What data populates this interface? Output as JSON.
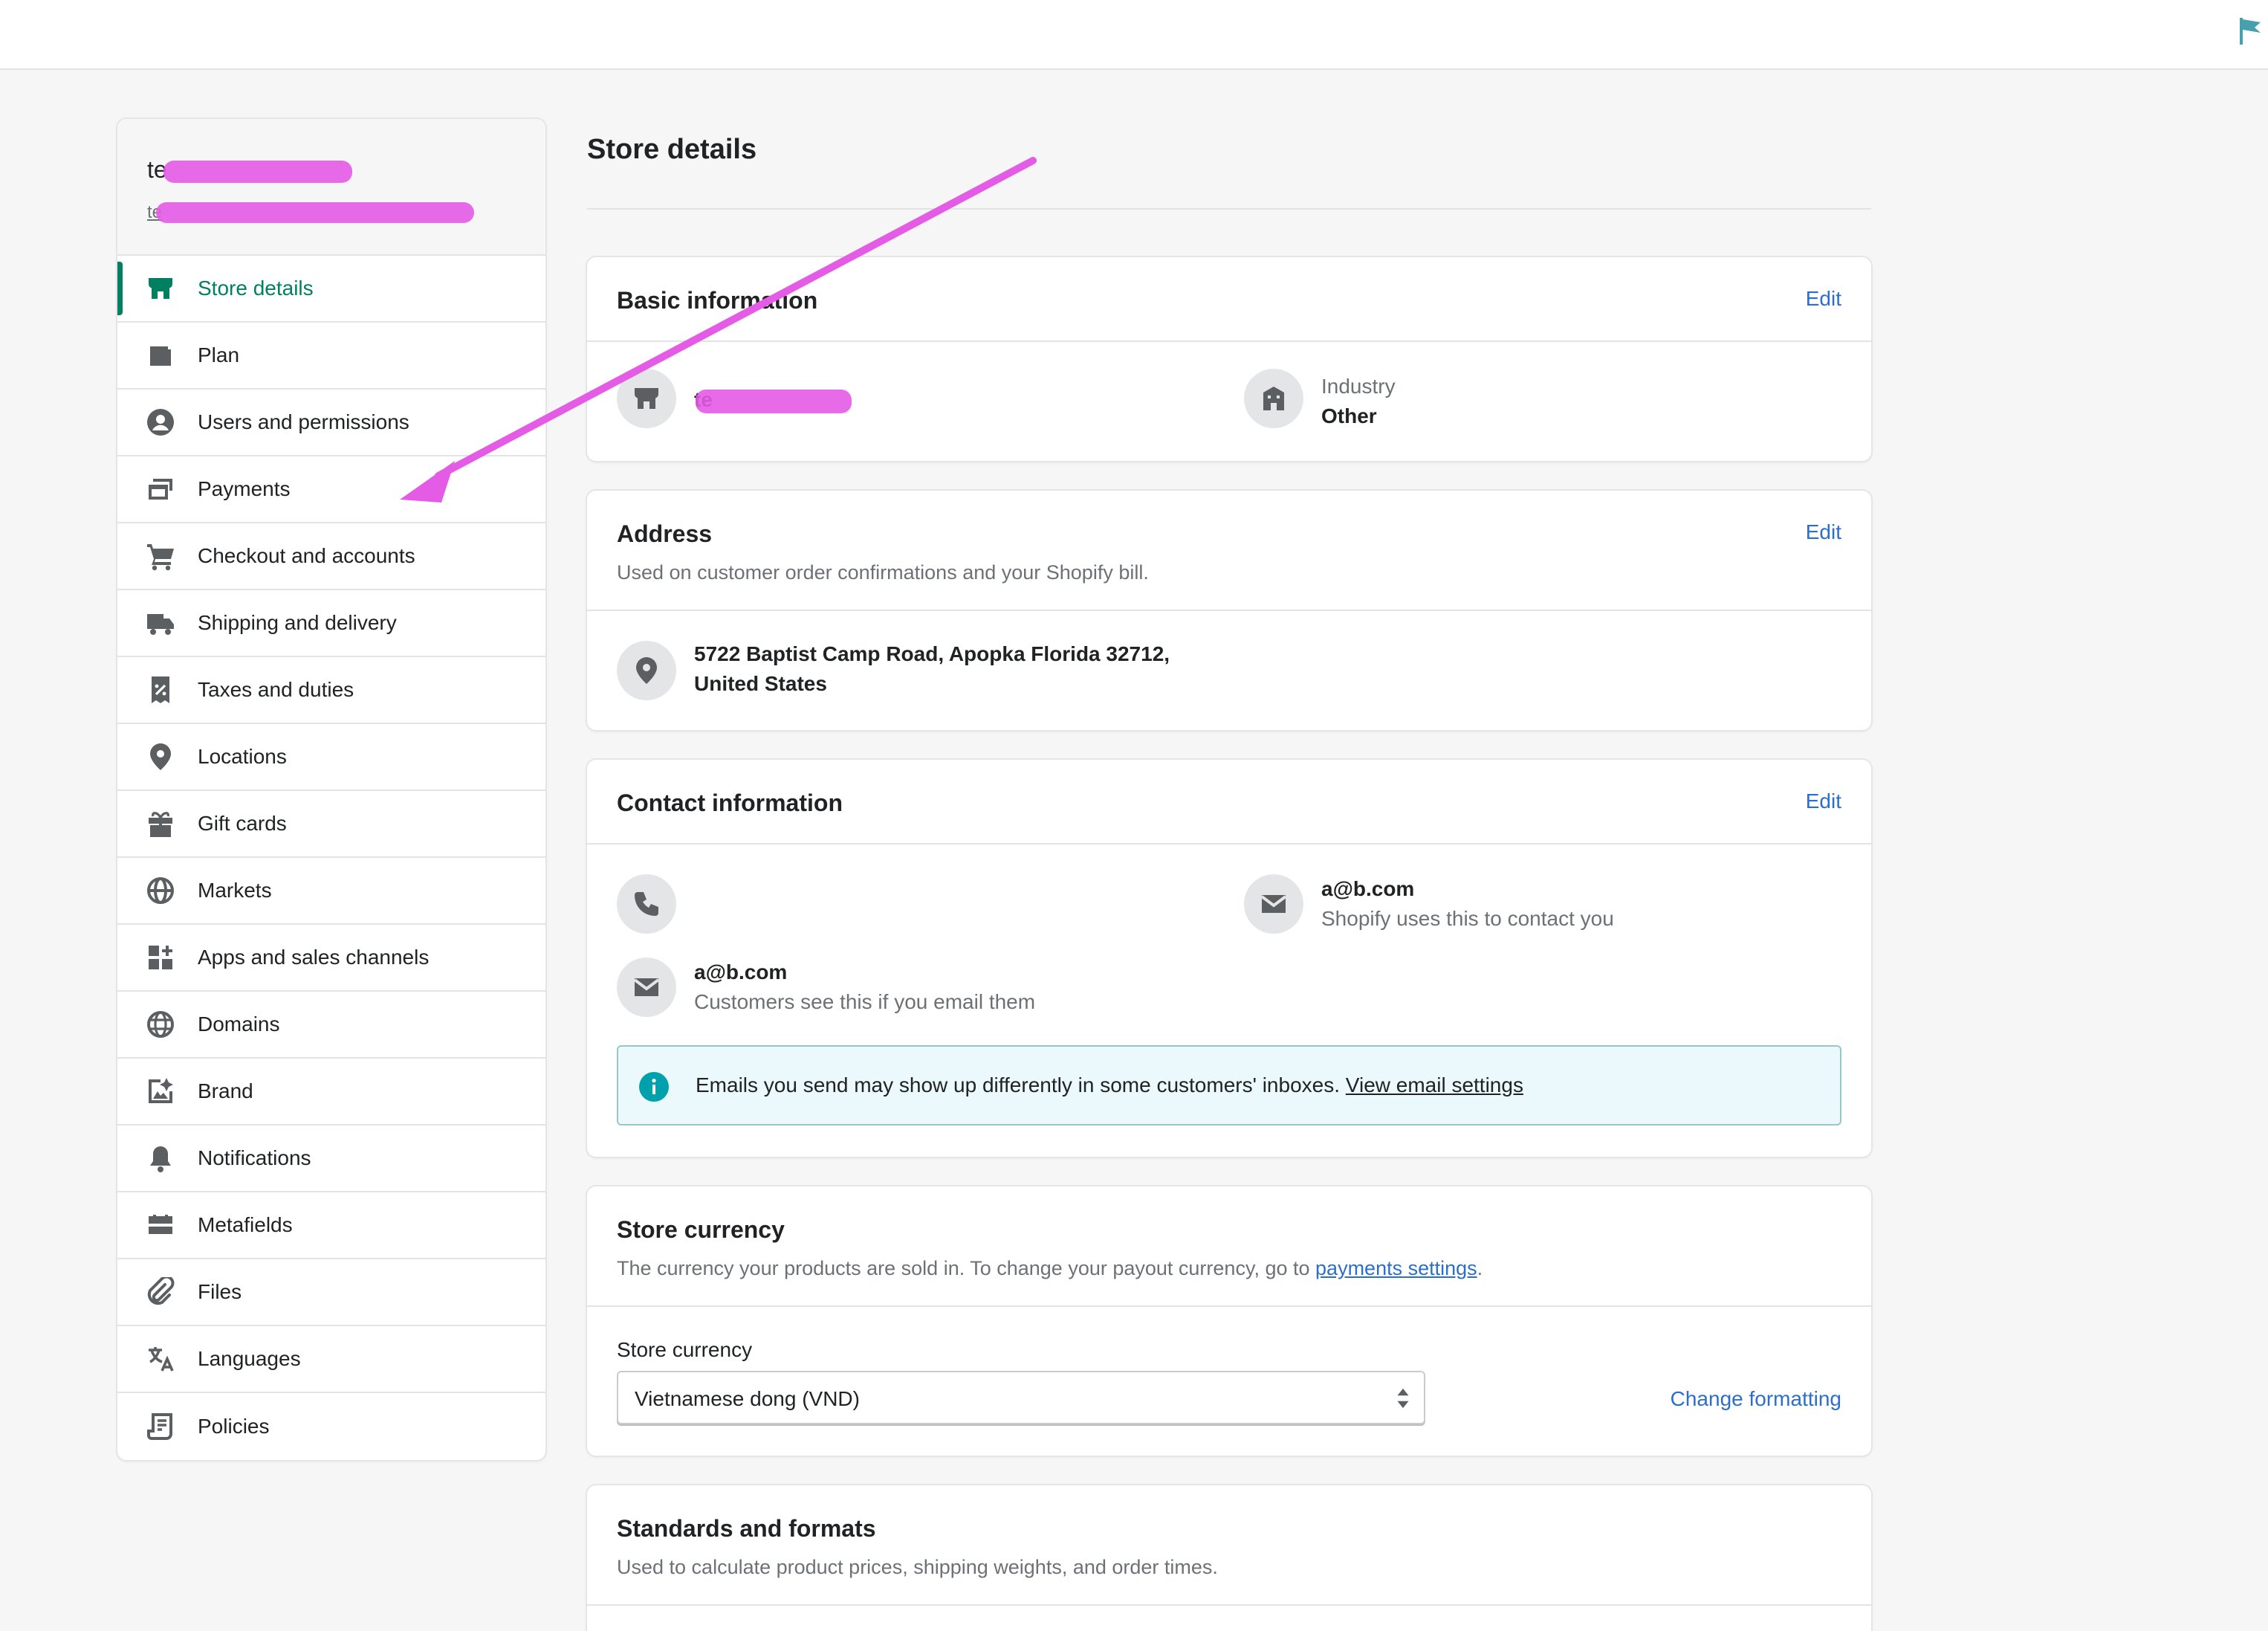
{
  "page": {
    "title": "Store details"
  },
  "sidebar": {
    "store_name": "te",
    "store_url": "te",
    "items": [
      {
        "label": "Store details",
        "icon": "store-icon",
        "active": true
      },
      {
        "label": "Plan",
        "icon": "wallet-icon"
      },
      {
        "label": "Users and permissions",
        "icon": "user-icon"
      },
      {
        "label": "Payments",
        "icon": "payments-icon"
      },
      {
        "label": "Checkout and accounts",
        "icon": "cart-icon"
      },
      {
        "label": "Shipping and delivery",
        "icon": "truck-icon"
      },
      {
        "label": "Taxes and duties",
        "icon": "tax-receipt-icon"
      },
      {
        "label": "Locations",
        "icon": "location-pin-icon"
      },
      {
        "label": "Gift cards",
        "icon": "gift-icon"
      },
      {
        "label": "Markets",
        "icon": "markets-globe-icon"
      },
      {
        "label": "Apps and sales channels",
        "icon": "apps-icon"
      },
      {
        "label": "Domains",
        "icon": "globe-icon"
      },
      {
        "label": "Brand",
        "icon": "brand-icon"
      },
      {
        "label": "Notifications",
        "icon": "bell-icon"
      },
      {
        "label": "Metafields",
        "icon": "metafields-icon"
      },
      {
        "label": "Files",
        "icon": "paperclip-icon"
      },
      {
        "label": "Languages",
        "icon": "translate-icon"
      },
      {
        "label": "Policies",
        "icon": "policy-document-icon"
      }
    ]
  },
  "basic_info": {
    "title": "Basic information",
    "edit": "Edit",
    "store_name": "te",
    "industry_label": "Industry",
    "industry_value": "Other"
  },
  "address": {
    "title": "Address",
    "edit": "Edit",
    "subtitle": "Used on customer order confirmations and your Shopify bill.",
    "line1": "5722 Baptist Camp Road, Apopka Florida 32712,",
    "line2": "United States"
  },
  "contact": {
    "title": "Contact information",
    "edit": "Edit",
    "store_email": "a@b.com",
    "store_email_note": "Shopify uses this to contact you",
    "sender_email": "a@b.com",
    "sender_email_note": "Customers see this if you email them",
    "banner_text": "Emails you send may show up differently in some customers' inboxes.",
    "banner_link": "View email settings"
  },
  "currency": {
    "title": "Store currency",
    "subtitle_prefix": "The currency your products are sold in. To change your payout currency, go to",
    "subtitle_link": "payments settings",
    "subtitle_suffix": ".",
    "field_label": "Store currency",
    "selected": "Vietnamese dong (VND)",
    "change_formatting": "Change formatting"
  },
  "standards": {
    "title": "Standards and formats",
    "subtitle": "Used to calculate product prices, shipping weights, and order times."
  },
  "colors": {
    "accent_green": "#008060",
    "link_blue": "#2c6ecb",
    "annotation_magenta": "#e45be6",
    "flag_teal": "#47a0ae"
  }
}
